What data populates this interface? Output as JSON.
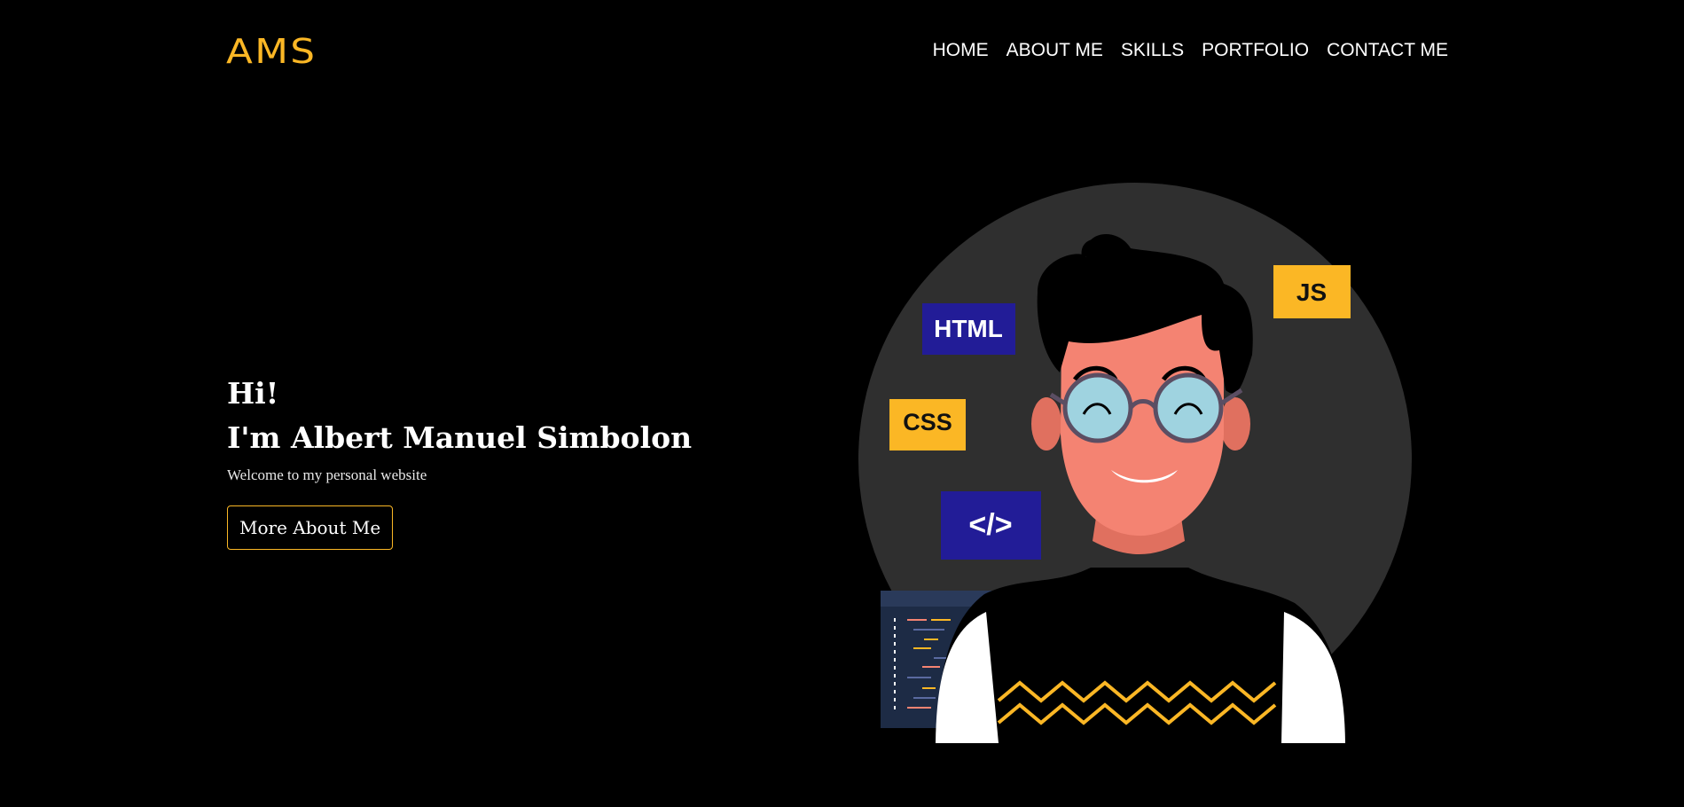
{
  "header": {
    "logo": "AMS",
    "nav": [
      "HOME",
      "ABOUT ME",
      "SKILLS",
      "PORTFOLIO",
      "CONTACT ME"
    ]
  },
  "hero": {
    "greeting": "Hi!",
    "name_line": "I'm Albert Manuel Simbolon",
    "subtitle": "Welcome to my personal website",
    "button_label": "More About Me"
  },
  "illustration": {
    "tags": [
      "HTML",
      "CSS",
      "</>",
      "JS"
    ]
  },
  "colors": {
    "background": "#000000",
    "accent": "#fbb725",
    "tag_blue": "#221c97",
    "circle": "#2f2f2f",
    "skin": "#f48372"
  }
}
